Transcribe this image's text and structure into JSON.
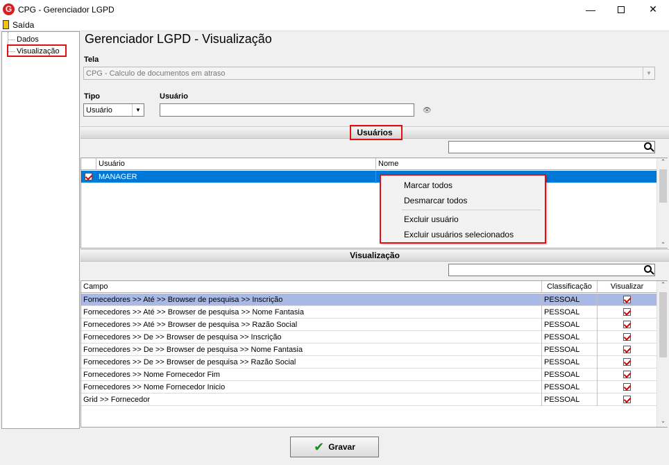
{
  "window": {
    "title": "CPG - Gerenciador LGPD",
    "app_icon": "G"
  },
  "menu": {
    "exit_label": "Saída"
  },
  "tree": {
    "items": [
      "Dados",
      "Visualização"
    ]
  },
  "page": {
    "title": "Gerenciador LGPD - Visualização"
  },
  "form": {
    "tela_label": "Tela",
    "tela_value": "CPG - Calculo de documentos em atraso",
    "tipo_label": "Tipo",
    "tipo_value": "Usuário",
    "usuario_label": "Usuário",
    "usuario_value": ""
  },
  "usuarios_section": {
    "title": "Usuários",
    "search_value": "",
    "columns": [
      "Usuário",
      "Nome"
    ],
    "rows": [
      {
        "checked": true,
        "usuario": "MANAGER",
        "nome": ""
      }
    ]
  },
  "context_menu": {
    "items": [
      "Marcar todos",
      "Desmarcar todos",
      "Excluir usuário",
      "Excluir usuários selecionados"
    ]
  },
  "visualizacao_section": {
    "title": "Visualização",
    "search_value": "",
    "columns": [
      "Campo",
      "Classificação",
      "Visualizar"
    ],
    "rows": [
      {
        "campo": "Fornecedores >> Até >> Browser de pesquisa >> Inscrição",
        "classificacao": "PESSOAL",
        "visualizar": true
      },
      {
        "campo": "Fornecedores >> Até >> Browser de pesquisa >> Nome Fantasia",
        "classificacao": "PESSOAL",
        "visualizar": true
      },
      {
        "campo": "Fornecedores >> Até >> Browser de pesquisa >> Razão Social",
        "classificacao": "PESSOAL",
        "visualizar": true
      },
      {
        "campo": "Fornecedores >> De >> Browser de pesquisa >> Inscrição",
        "classificacao": "PESSOAL",
        "visualizar": true
      },
      {
        "campo": "Fornecedores >> De >> Browser de pesquisa >> Nome Fantasia",
        "classificacao": "PESSOAL",
        "visualizar": true
      },
      {
        "campo": "Fornecedores >> De >> Browser de pesquisa >> Razão Social",
        "classificacao": "PESSOAL",
        "visualizar": true
      },
      {
        "campo": "Fornecedores >> Nome Fornecedor Fim",
        "classificacao": "PESSOAL",
        "visualizar": true
      },
      {
        "campo": "Fornecedores >> Nome Fornecedor Inicio",
        "classificacao": "PESSOAL",
        "visualizar": true
      },
      {
        "campo": "Grid >> Fornecedor",
        "classificacao": "PESSOAL",
        "visualizar": true
      }
    ]
  },
  "footer": {
    "save_label": "Gravar"
  },
  "colors": {
    "selection": "#0078d7",
    "row_highlight": "#a9b9e6",
    "annotation": "#e01010",
    "check": "#d00000"
  }
}
